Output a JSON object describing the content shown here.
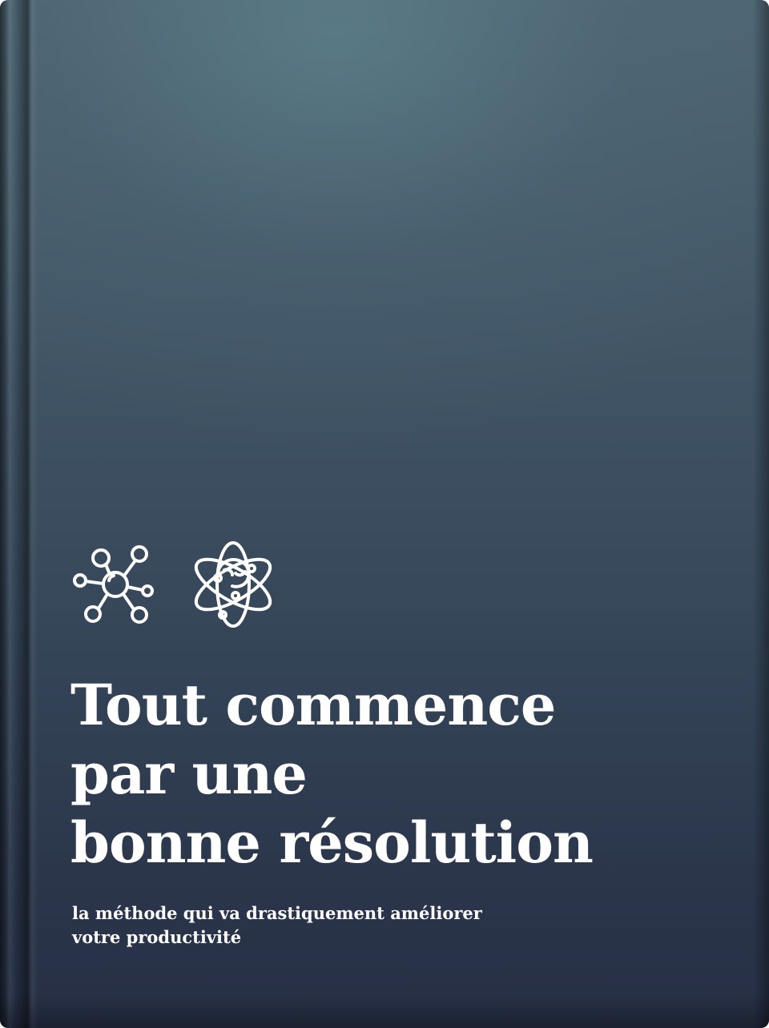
{
  "cover": {
    "title_lines": [
      "Tout commence",
      "par une",
      "bonne résolution"
    ],
    "subtitle_lines": [
      "la méthode qui va drastiquement améliorer",
      "votre productivité"
    ],
    "icons": [
      "network-molecule-icon",
      "brain-atom-icon"
    ],
    "colors": {
      "background_top": "#4f6573",
      "background_bottom": "#262f45",
      "text": "#ffffff"
    }
  }
}
